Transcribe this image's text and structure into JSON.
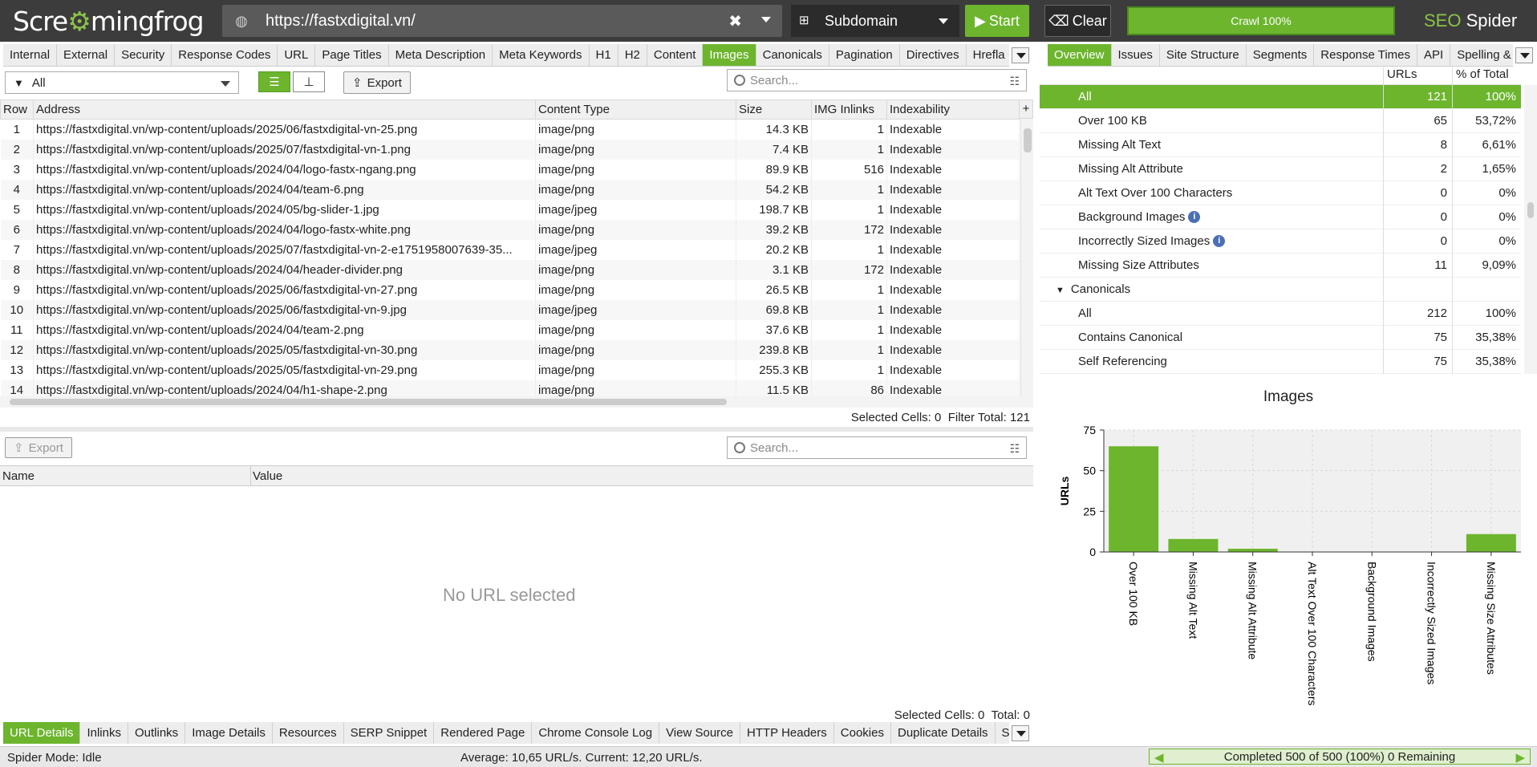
{
  "app": {
    "logo_a": "Scre",
    "logo_b": "mingfrog",
    "seo_a": "SEO",
    "seo_b": " Spider"
  },
  "top": {
    "url": "https://fastxdigital.vn/",
    "mode": "Subdomain",
    "start": "Start",
    "clear": "Clear",
    "crawl": "Crawl 100%"
  },
  "tabs": [
    "Internal",
    "External",
    "Security",
    "Response Codes",
    "URL",
    "Page Titles",
    "Meta Description",
    "Meta Keywords",
    "H1",
    "H2",
    "Content",
    "Images",
    "Canonicals",
    "Pagination",
    "Directives",
    "Hrefla"
  ],
  "active_tab": "Images",
  "right_tabs": [
    "Overview",
    "Issues",
    "Site Structure",
    "Segments",
    "Response Times",
    "API",
    "Spelling &"
  ],
  "right_active": "Overview",
  "toolbar": {
    "filter": "All",
    "export": "Export",
    "search_placeholder": "Search..."
  },
  "columns": [
    "Row",
    "Address",
    "Content Type",
    "Size",
    "IMG Inlinks",
    "Indexability"
  ],
  "rows": [
    [
      "1",
      "https://fastxdigital.vn/wp-content/uploads/2025/06/fastxdigital-vn-25.png",
      "image/png",
      "14.3 KB",
      "1",
      "Indexable"
    ],
    [
      "2",
      "https://fastxdigital.vn/wp-content/uploads/2025/07/fastxdigital-vn-1.png",
      "image/png",
      "7.4 KB",
      "1",
      "Indexable"
    ],
    [
      "3",
      "https://fastxdigital.vn/wp-content/uploads/2024/04/logo-fastx-ngang.png",
      "image/png",
      "89.9 KB",
      "516",
      "Indexable"
    ],
    [
      "4",
      "https://fastxdigital.vn/wp-content/uploads/2024/04/team-6.png",
      "image/png",
      "54.2 KB",
      "1",
      "Indexable"
    ],
    [
      "5",
      "https://fastxdigital.vn/wp-content/uploads/2024/05/bg-slider-1.jpg",
      "image/jpeg",
      "198.7 KB",
      "1",
      "Indexable"
    ],
    [
      "6",
      "https://fastxdigital.vn/wp-content/uploads/2024/04/logo-fastx-white.png",
      "image/png",
      "39.2 KB",
      "172",
      "Indexable"
    ],
    [
      "7",
      "https://fastxdigital.vn/wp-content/uploads/2025/07/fastxdigital-vn-2-e1751958007639-35...",
      "image/jpeg",
      "20.2 KB",
      "1",
      "Indexable"
    ],
    [
      "8",
      "https://fastxdigital.vn/wp-content/uploads/2024/04/header-divider.png",
      "image/png",
      "3.1 KB",
      "172",
      "Indexable"
    ],
    [
      "9",
      "https://fastxdigital.vn/wp-content/uploads/2025/06/fastxdigital-vn-27.png",
      "image/png",
      "26.5 KB",
      "1",
      "Indexable"
    ],
    [
      "10",
      "https://fastxdigital.vn/wp-content/uploads/2025/06/fastxdigital-vn-9.jpg",
      "image/jpeg",
      "69.8 KB",
      "1",
      "Indexable"
    ],
    [
      "11",
      "https://fastxdigital.vn/wp-content/uploads/2024/04/team-2.png",
      "image/png",
      "37.6 KB",
      "1",
      "Indexable"
    ],
    [
      "12",
      "https://fastxdigital.vn/wp-content/uploads/2025/05/fastxdigital-vn-30.png",
      "image/png",
      "239.8 KB",
      "1",
      "Indexable"
    ],
    [
      "13",
      "https://fastxdigital.vn/wp-content/uploads/2025/05/fastxdigital-vn-29.png",
      "image/png",
      "255.3 KB",
      "1",
      "Indexable"
    ],
    [
      "14",
      "https://fastxdigital.vn/wp-content/uploads/2024/04/h1-shape-2.png",
      "image/png",
      "11.5 KB",
      "86",
      "Indexable"
    ]
  ],
  "status1": {
    "selected": "Selected Cells:",
    "selected_val": "0",
    "filter_total": "Filter Total:",
    "filter_val": "121"
  },
  "lower": {
    "export": "Export",
    "search_placeholder": "Search...",
    "col_name": "Name",
    "col_value": "Value",
    "empty": "No URL selected",
    "selected": "Selected Cells:",
    "selected_val": "0",
    "total": "Total:",
    "total_val": "0"
  },
  "bottom_tabs": [
    "URL Details",
    "Inlinks",
    "Outlinks",
    "Image Details",
    "Resources",
    "SERP Snippet",
    "Rendered Page",
    "Chrome Console Log",
    "View Source",
    "HTTP Headers",
    "Cookies",
    "Duplicate Details",
    "Str"
  ],
  "bottom_active": "URL Details",
  "statusbar": {
    "mode": "Spider Mode: Idle",
    "avg": "Average: 10,65 URL/s. Current: 12,20 URL/s.",
    "completed": "Completed 500 of 500 (100%) 0 Remaining"
  },
  "overview": {
    "col_urls": "URLs",
    "col_pct": "% of Total",
    "rows": [
      {
        "label": "All",
        "urls": "121",
        "pct": "100%",
        "indent": 2,
        "selected": true
      },
      {
        "label": "Over 100 KB",
        "urls": "65",
        "pct": "53,72%",
        "indent": 2
      },
      {
        "label": "Missing Alt Text",
        "urls": "8",
        "pct": "6,61%",
        "indent": 2
      },
      {
        "label": "Missing Alt Attribute",
        "urls": "2",
        "pct": "1,65%",
        "indent": 2
      },
      {
        "label": "Alt Text Over 100 Characters",
        "urls": "0",
        "pct": "0%",
        "indent": 2
      },
      {
        "label": "Background Images",
        "urls": "0",
        "pct": "0%",
        "indent": 2,
        "info": true
      },
      {
        "label": "Incorrectly Sized Images",
        "urls": "0",
        "pct": "0%",
        "indent": 2,
        "info": true
      },
      {
        "label": "Missing Size Attributes",
        "urls": "11",
        "pct": "9,09%",
        "indent": 2
      },
      {
        "label": "Canonicals",
        "urls": "",
        "pct": "",
        "indent": 1,
        "group": true
      },
      {
        "label": "All",
        "urls": "212",
        "pct": "100%",
        "indent": 2
      },
      {
        "label": "Contains Canonical",
        "urls": "75",
        "pct": "35,38%",
        "indent": 2
      },
      {
        "label": "Self Referencing",
        "urls": "75",
        "pct": "35,38%",
        "indent": 2
      }
    ]
  },
  "chart_data": {
    "type": "bar",
    "title": "Images",
    "ylabel": "URLs",
    "xlabel": "",
    "categories": [
      "Over 100 KB",
      "Missing Alt Text",
      "Missing Alt Attribute",
      "Alt Text Over 100 Characters",
      "Background Images",
      "Incorrectly Sized Images",
      "Missing Size Attributes"
    ],
    "values": [
      65,
      8,
      2,
      0,
      0,
      0,
      11
    ],
    "ylim": [
      0,
      75
    ],
    "yticks": [
      0,
      25,
      50,
      75
    ],
    "grid": true,
    "color": "#6cb52d"
  }
}
